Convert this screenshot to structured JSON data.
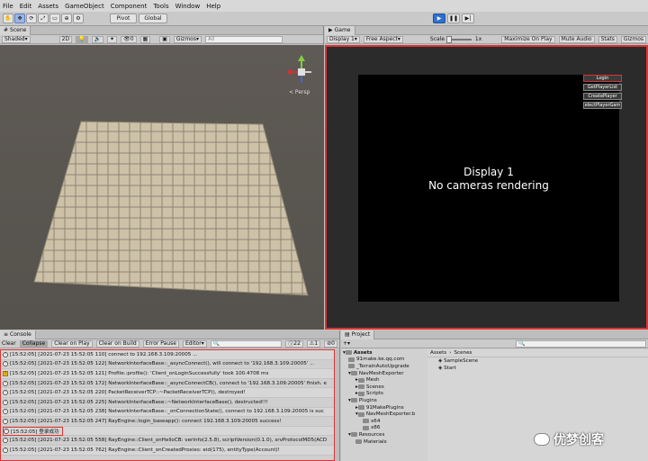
{
  "menu": [
    "File",
    "Edit",
    "Assets",
    "GameObject",
    "Component",
    "Tools",
    "Window",
    "Help"
  ],
  "toolbar": {
    "pivot": "Pivot",
    "global": "Global"
  },
  "scene": {
    "tab": "Scene",
    "shading": "Shaded",
    "mode2d": "2D",
    "gizmos": "Gizmos",
    "layers": "0",
    "search_placeholder": "All",
    "persp": "< Persp"
  },
  "game": {
    "tab": "Game",
    "display": "Display 1",
    "aspect": "Free Aspect",
    "scale_label": "Scale",
    "scale_value": "1x",
    "maximize": "Maximize On Play",
    "mute": "Mute Audio",
    "stats": "Stats",
    "gizmos": "Gizmos",
    "message_line1": "Display 1",
    "message_line2": "No cameras rendering",
    "buttons": [
      "Login",
      "GetPlayerList",
      "CreatePlayer",
      "electPlayerGam"
    ]
  },
  "console": {
    "tab": "Console",
    "clear": "Clear",
    "collapse": "Collapse",
    "clear_on_play": "Clear on Play",
    "clear_on_build": "Clear on Build",
    "error_pause": "Error Pause",
    "editor": "Editor",
    "count_info": "22",
    "count_warn": "1",
    "count_err": "0",
    "logs": [
      "[15:52:05] [2021-07-23 15:52:05 110] connect to 192.168.3.109:20005 ...",
      "[15:52:05] [2021-07-23 15:52:05 122] NetworkInterfaceBase::_asyncConnect(), will connect to '192.168.3.109:20005' ...",
      "[15:52:05] [2021-07-23 15:52:05 121] Profile::profile(): 'Client_onLoginSuccessfully' took 100.4708 ms",
      "[15:52:05] [2021-07-23 15:52:05 172] NetworkInterfaceBase::_asyncConnectCB(), connect to '192.168.3.109:20005' finish. e",
      "[15:52:05] [2021-07-23 15:52:05 220] PacketReceiverTCP::~PacketReceiverTCP(), destroyed!",
      "[15:52:05] [2021-07-23 15:52:05 225] NetworkInterfaceBase::~NetworkInterfaceBase(), destructed!!!",
      "[15:52:05] [2021-07-23 15:52:05 238] NetworkInterfaceBase::_onConnectionState(), connect to 192.168.3.109:20005 is suc",
      "[15:52:05] [2021-07-23 15:52:05 247] RayEngine::login_baseapp(): connect 192.168.3.109:20005 success!",
      "[15:52:05] 登录成功",
      "[15:52:05] [2021-07-23 15:52:05 558] RayEngine::Client_onHelloCB: verInfo(2.5.8), scriptVersion(0.1.0), srvProtocolMD5(ACD",
      "[15:52:05] [2021-07-23 15:52:05 762] RayEngine::Client_onCreatedProxies: eid(175), entityType(Account)!"
    ]
  },
  "project": {
    "tab": "Project",
    "breadcrumb_root": "Assets",
    "breadcrumb_child": "Scenes",
    "tree": [
      "Assets",
      "91make.ke.qq.com",
      "_TerrainAutoUpgrade",
      "NavMeshExporter",
      "Mesh",
      "Scenes",
      "Scripts",
      "Plugins",
      "91MakePlugins",
      "NavMeshExporter.b",
      "x64",
      "x86",
      "Resources",
      "Materials"
    ],
    "files": [
      "SampleScene",
      "Start"
    ]
  },
  "watermark": "优梦创客"
}
